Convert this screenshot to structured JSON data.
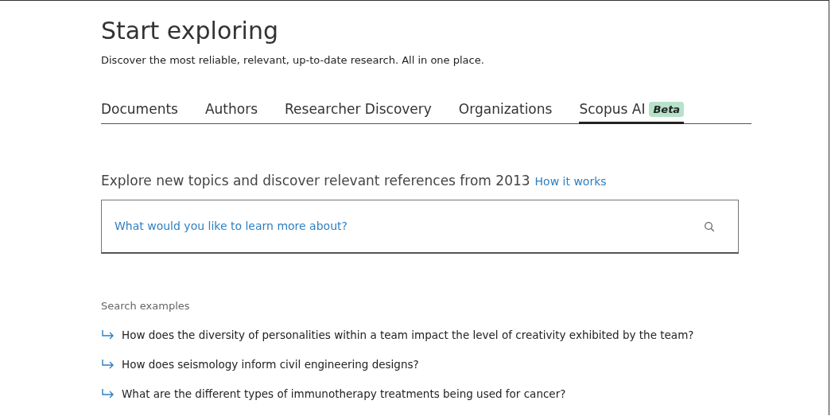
{
  "header": {
    "title": "Start exploring",
    "subtitle": "Discover the most reliable, relevant, up-to-date research. All in one place."
  },
  "tabs": [
    {
      "label": "Documents",
      "selected": false
    },
    {
      "label": "Authors",
      "selected": false
    },
    {
      "label": "Researcher Discovery",
      "selected": false
    },
    {
      "label": "Organizations",
      "selected": false
    },
    {
      "label": "Scopus AI",
      "badge": "Beta",
      "selected": true
    }
  ],
  "intro": {
    "text": "Explore new topics and discover relevant references from 2013",
    "link": "How it works"
  },
  "search": {
    "placeholder": "What would you like to learn more about?"
  },
  "examples": {
    "heading": "Search examples",
    "items": [
      "How does the diversity of personalities within a team impact the level of creativity exhibited by the team?",
      "How does seismology inform civil engineering designs?",
      "What are the different types of immunotherapy treatments being used for cancer?"
    ]
  }
}
